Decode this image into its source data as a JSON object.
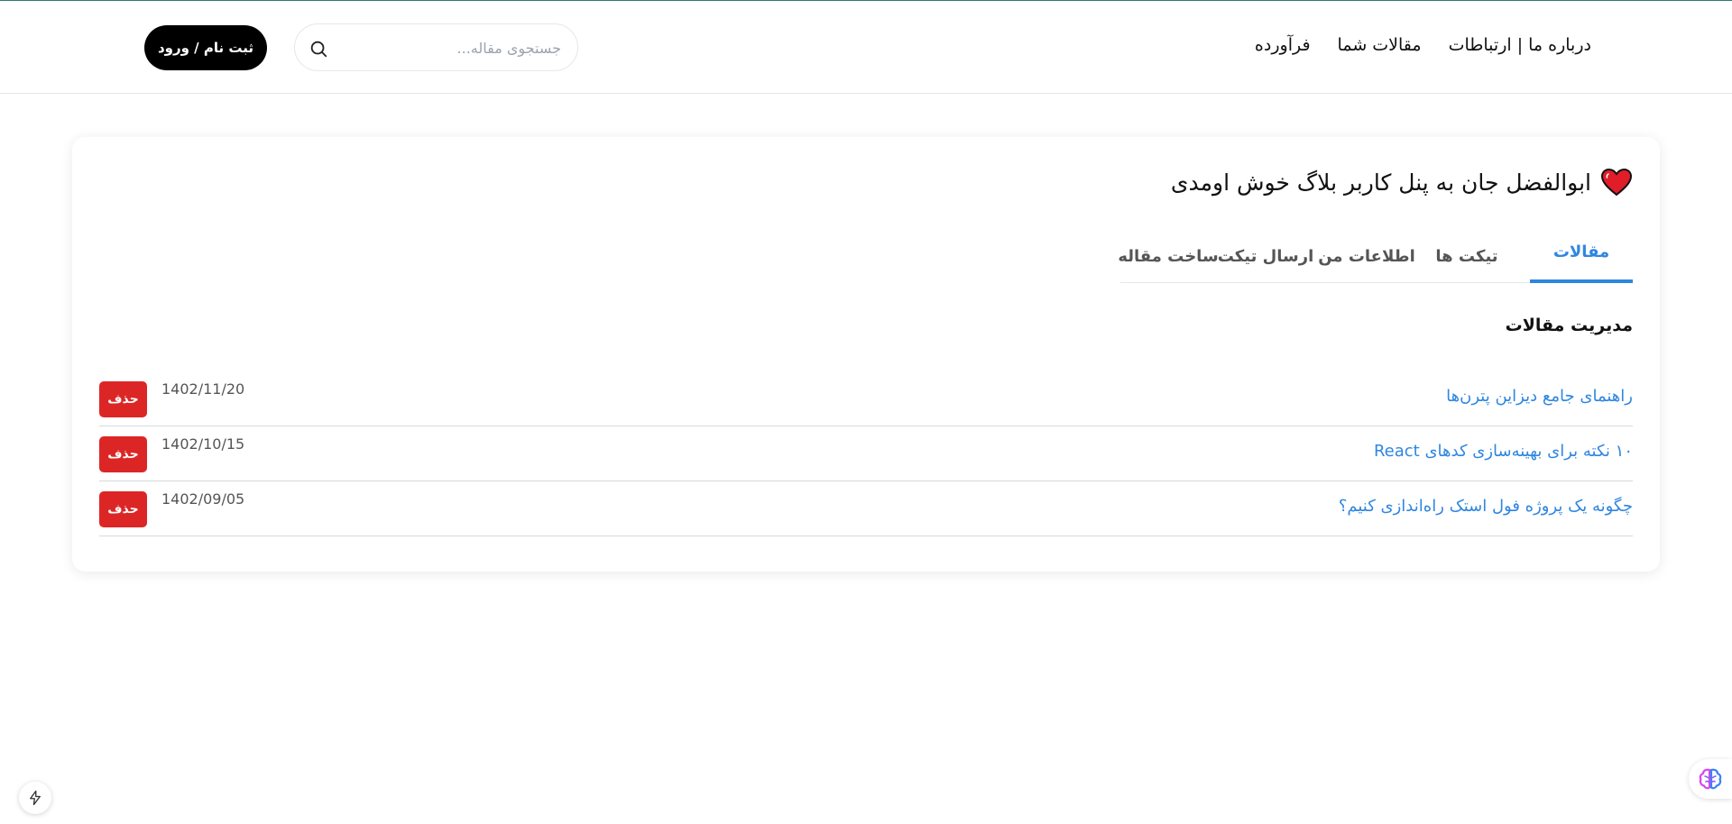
{
  "colors": {
    "accent": "#2f86e0",
    "danger": "#dc2626",
    "primary_button": "#000000",
    "heart": "#e11d2a"
  },
  "header": {
    "nav": [
      {
        "label": "فرآورده"
      },
      {
        "label": "مقالات شما"
      },
      {
        "label": "درباره ما | ارتباطات"
      }
    ],
    "search": {
      "placeholder": "جستجوی مقاله...",
      "value": "",
      "icon": "search-icon"
    },
    "auth_label": "ثبت نام / ورود"
  },
  "panel": {
    "welcome": "ابوالفضل جان به پنل کاربر بلاگ خوش اومدی",
    "welcome_icon": "heart-icon",
    "tabs": [
      {
        "label": "مقالات",
        "active": true
      },
      {
        "label": "تیکت ها",
        "active": false
      },
      {
        "label": "اطلاعات من",
        "active": false
      },
      {
        "label": "ارسال تیکت",
        "active": false
      },
      {
        "label": "ساخت مقاله",
        "active": false
      }
    ],
    "section_title": "مدیریت مقالات",
    "articles": [
      {
        "title": "راهنمای جامع دیزاین پترن‌ها",
        "date": "1402/11/20",
        "delete_label": "حذف"
      },
      {
        "title": "۱۰ نکته برای بهینه‌سازی کدهای React",
        "date": "1402/10/15",
        "delete_label": "حذف"
      },
      {
        "title": "چگونه یک پروژه فول استک راه‌اندازی کنیم؟",
        "date": "1402/09/05",
        "delete_label": "حذف"
      }
    ]
  },
  "floating": {
    "left_icon": "bolt-icon",
    "right_icon": "brain-icon"
  }
}
